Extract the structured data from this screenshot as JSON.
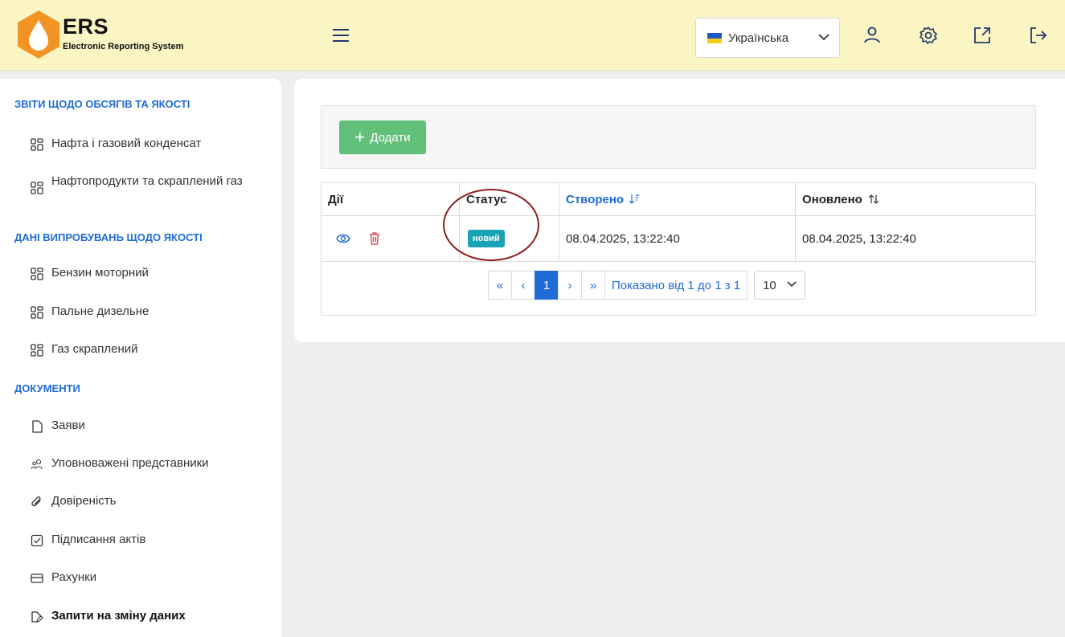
{
  "header": {
    "logo_title": "ERS",
    "logo_subtitle": "Electronic Reporting System",
    "language": "Українська",
    "icons": [
      "menu-icon",
      "user-icon",
      "gear-icon",
      "external-link-icon",
      "logout-icon"
    ]
  },
  "sidebar": {
    "sections": [
      {
        "title": "ЗВІТИ ЩОДО ОБСЯГІВ ТА ЯКОСТІ",
        "items": [
          {
            "label": "Нафта і газовий конденсат",
            "icon": "grid-icon"
          },
          {
            "label": "Нафтопродукти та скраплений газ",
            "icon": "grid-icon"
          }
        ]
      },
      {
        "title": "ДАНІ ВИПРОБУВАНЬ ЩОДО ЯКОСТІ",
        "items": [
          {
            "label": "Бензин моторний",
            "icon": "grid-icon"
          },
          {
            "label": "Пальне дизельне",
            "icon": "grid-icon"
          },
          {
            "label": "Газ скраплений",
            "icon": "grid-icon"
          }
        ]
      },
      {
        "title": "ДОКУМЕНТИ",
        "items": [
          {
            "label": "Заяви",
            "icon": "file-icon"
          },
          {
            "label": "Уповноважені представники",
            "icon": "users-icon"
          },
          {
            "label": "Довіреність",
            "icon": "paperclip-icon"
          },
          {
            "label": "Підписання актів",
            "icon": "checkbox-icon"
          },
          {
            "label": "Рахунки",
            "icon": "card-icon"
          },
          {
            "label": "Запити на зміну даних",
            "icon": "edit-file-icon",
            "active": true
          }
        ]
      }
    ]
  },
  "toolbar": {
    "add_label": "Додати"
  },
  "table": {
    "columns": [
      "Дії",
      "Статус",
      "Створено",
      "Оновлено"
    ],
    "rows": [
      {
        "status": "новий",
        "created": "08.04.2025, 13:22:40",
        "updated": "08.04.2025, 13:22:40"
      }
    ]
  },
  "pagination": {
    "first": "«",
    "prev": "‹",
    "current": "1",
    "next": "›",
    "last": "»",
    "info": "Показано від 1 до 1 з 1",
    "page_size": "10"
  },
  "colors": {
    "header_bg": "#fbf5c4",
    "accent": "#1e6bd6",
    "add_button": "#63c07a",
    "badge": "#1aa3b7",
    "annotation_circle": "#8c1d1d"
  }
}
